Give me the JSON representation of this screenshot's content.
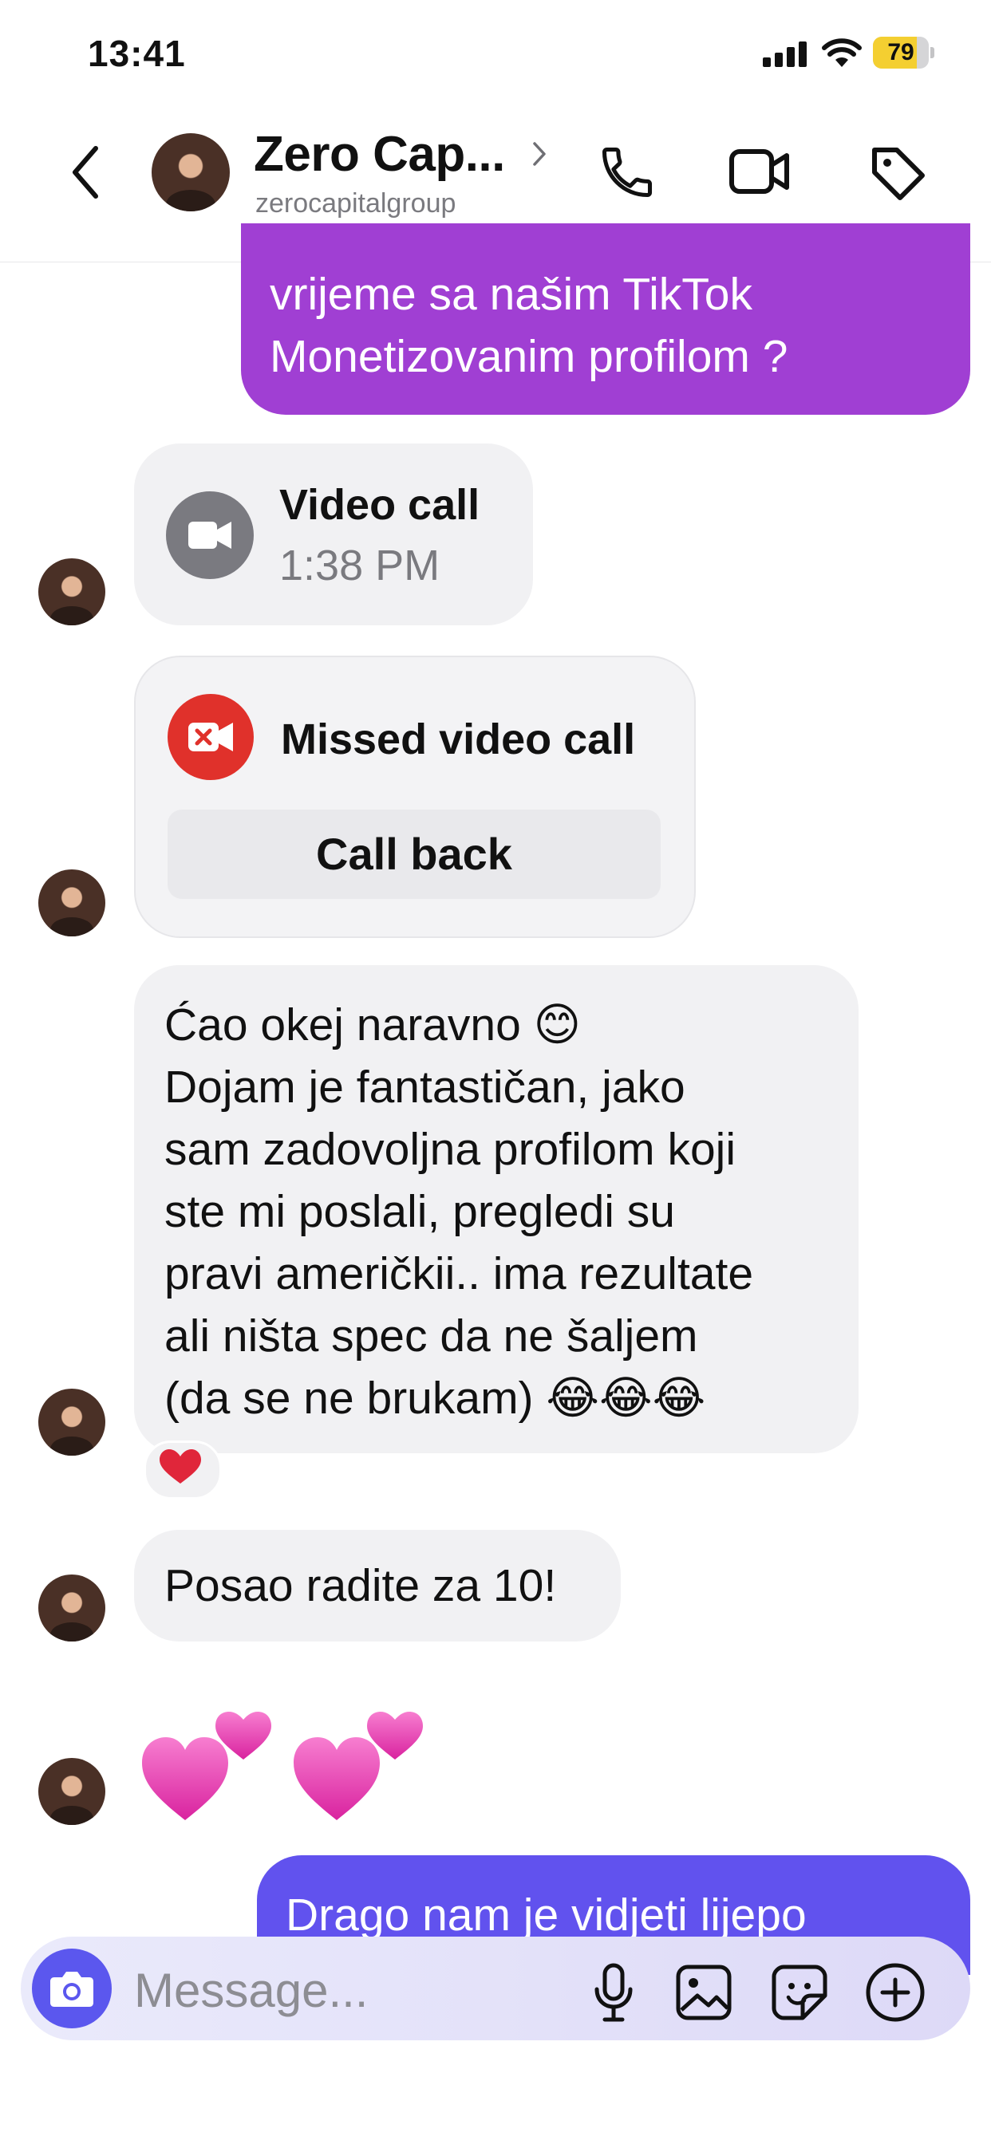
{
  "status_bar": {
    "time": "13:41",
    "battery_percent": "79",
    "battery_level": 0.79
  },
  "header": {
    "name": "Zero Cap...",
    "username": "zerocapitalgroup"
  },
  "messages": {
    "outgoing_1": {
      "lines": [
        "vrijeme sa našim TikTok",
        "Monetizovanim profilom ?"
      ]
    },
    "video_call": {
      "title": "Video call",
      "time": "1:38 PM"
    },
    "missed_call": {
      "title": "Missed video call",
      "button": "Call back"
    },
    "incoming_long": {
      "lines": [
        "Ćao okej naravno 😊",
        "Dojam je fantastičan, jako",
        "sam zadovoljna profilom koji",
        "ste mi poslali, pregledi su",
        "pravi američkii.. ima rezultate",
        "ali ništa spec da ne šaljem",
        "(da se ne brukam) 😂😂😂"
      ],
      "reaction": "❤️"
    },
    "incoming_short": {
      "text": "Posao radite za 10!"
    },
    "outgoing_2": {
      "text": "Drago nam je vidjeti lijepo"
    }
  },
  "composer": {
    "placeholder": "Message..."
  },
  "colors": {
    "outgoing_purple": "#a03fd3",
    "outgoing_blue": "#6152ee",
    "incoming_gray": "#f1f1f3",
    "camera_blue": "#5b57ee",
    "missed_red": "#e0312b"
  },
  "icons": [
    "back-chevron-icon",
    "phone-icon",
    "video-camera-icon",
    "tag-icon",
    "camera-icon",
    "microphone-icon",
    "gallery-icon",
    "sticker-icon",
    "plus-icon",
    "heart-icon"
  ]
}
